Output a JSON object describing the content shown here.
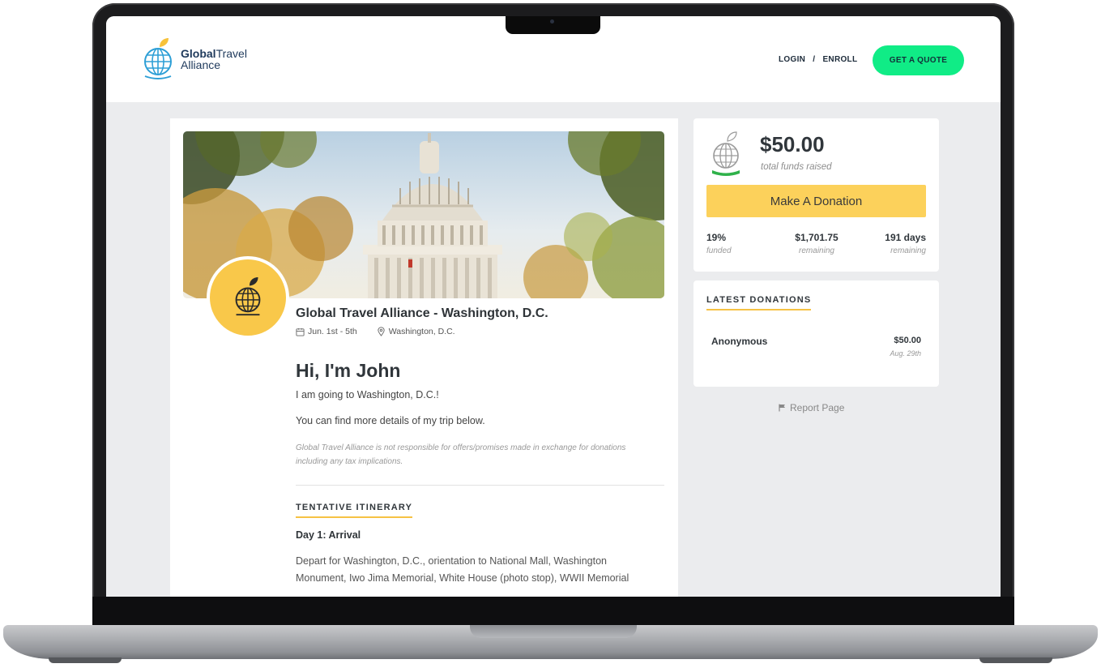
{
  "brand": {
    "name_bold": "Global",
    "name_rest": "Travel",
    "name_line2": "Alliance"
  },
  "nav": {
    "login": "LOGIN",
    "separator": "/",
    "enroll": "ENROLL",
    "quote_button": "GET A QUOTE"
  },
  "trip": {
    "title": "Global Travel Alliance - Washington, D.C.",
    "dates": "Jun. 1st - 5th",
    "location": "Washington, D.C."
  },
  "profile": {
    "greeting": "Hi, I'm John",
    "paragraph_1": "I am going to Washington, D.C.!",
    "paragraph_2": "You can find more details of my trip below.",
    "disclaimer": "Global Travel Alliance is not responsible for offers/promises made in exchange for donations including any tax implications."
  },
  "itinerary": {
    "heading": "TENTATIVE ITINERARY",
    "days": [
      {
        "title": "Day 1: Arrival",
        "text": "Depart for Washington, D.C., orientation to National Mall, Washington Monument, Iwo Jima Memorial, White House (photo stop), WWII Memorial"
      }
    ]
  },
  "funds": {
    "amount": "$50.00",
    "label": "total funds raised",
    "donate_button": "Make A Donation",
    "stats": [
      {
        "value": "19%",
        "label": "funded"
      },
      {
        "value": "$1,701.75",
        "label": "remaining"
      },
      {
        "value": "191 days",
        "label": "remaining"
      }
    ]
  },
  "donations": {
    "heading": "LATEST DONATIONS",
    "items": [
      {
        "name": "Anonymous",
        "amount": "$50.00",
        "date": "Aug. 29th"
      }
    ]
  },
  "report": {
    "label": "Report Page"
  },
  "colors": {
    "accent_green": "#10ec86",
    "donate_yellow": "#fcd15b",
    "avatar_yellow": "#f9c84a",
    "underline_gold": "#f6c244",
    "brand_navy": "#1f3a5c"
  },
  "icons": {
    "logo": "globe-leaf-icon",
    "calendar": "calendar-icon",
    "location": "map-pin-icon",
    "report": "flag-icon"
  }
}
